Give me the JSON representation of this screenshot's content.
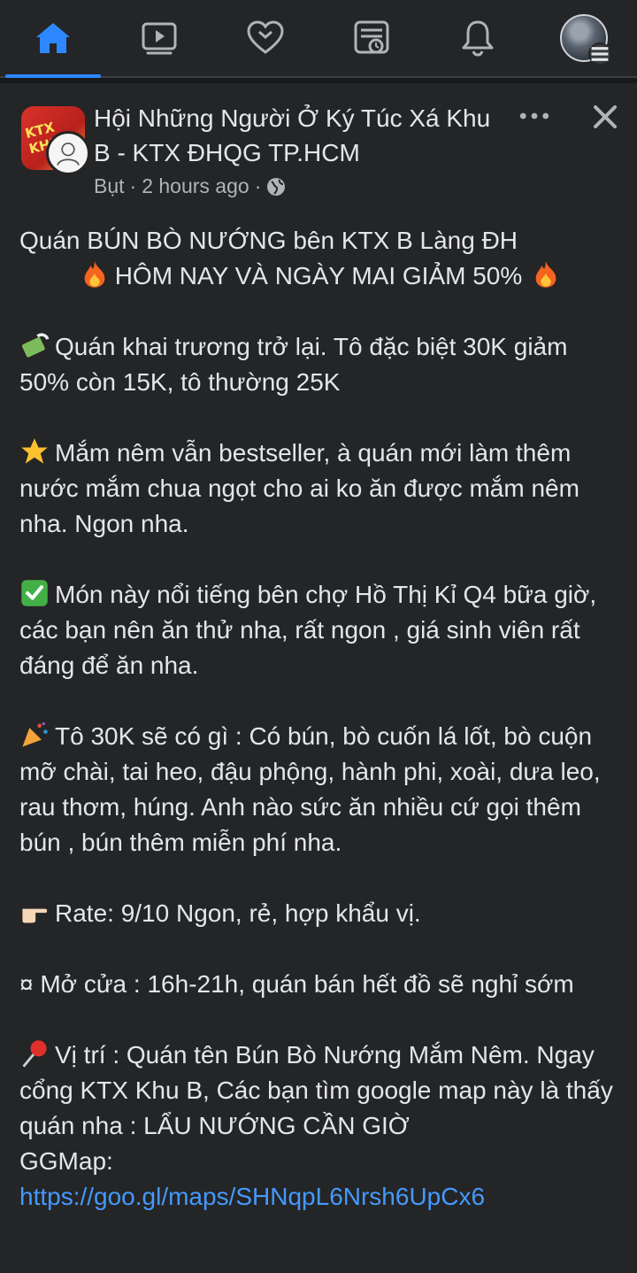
{
  "nav": {
    "items": [
      {
        "name": "home",
        "active": true
      },
      {
        "name": "watch",
        "active": false
      },
      {
        "name": "dating",
        "active": false
      },
      {
        "name": "news-feed",
        "active": false
      },
      {
        "name": "notifications",
        "active": false
      },
      {
        "name": "profile-menu",
        "active": false
      }
    ],
    "accent_color": "#2d88ff"
  },
  "post": {
    "group_name": "Hội Những Người Ở Ký Túc Xá Khu B - KTX ĐHQG TP.HCM",
    "group_avatar_text": "KTX KHU",
    "author": "Bụt",
    "separator": "·",
    "time": "2 hours ago",
    "separator2": "·",
    "audience_icon": "globe-icon",
    "body": {
      "title_line": "Quán BÚN BÒ NƯỚNG bên KTX B Làng ĐH",
      "promo_line": "HÔM NAY VÀ NGÀY MAI GIẢM 50%",
      "p1": "Quán khai trương trở lại. Tô đặc biệt 30K giảm 50% còn 15K, tô thường 25K",
      "p2": "Mắm nêm vẫn bestseller, à quán mới làm thêm nước mắm chua ngọt cho ai ko ăn được mắm nêm nha. Ngon nha.",
      "p3": "Món này nổi tiếng bên chợ Hồ Thị Kỉ Q4 bữa giờ, các bạn nên ăn thử nha, rất ngon , giá sinh viên rất đáng để ăn nha.",
      "p4": "Tô 30K sẽ có gì : Có bún, bò cuốn lá lốt, bò cuộn mỡ chài, tai heo, đậu phộng, hành phi, xoài, dưa leo, rau thơm, húng. Anh nào sức ăn nhiều cứ gọi thêm bún , bún thêm miễn phí nha.",
      "p5": "Rate: 9/10 Ngon, rẻ, hợp khẩu vị.",
      "p6": "¤ Mở cửa : 16h-21h, quán bán hết đồ sẽ nghỉ sớm",
      "p7": "Vị trí : Quán tên Bún Bò Nướng Mắm Nêm. Ngay cổng KTX Khu B, Các bạn tìm google map này là thấy quán nha : LẨU NƯỚNG CẦN GIỜ",
      "p7b": "GGMap:",
      "link": "https://goo.gl/maps/SHNqpL6Nrsh6UpCx6"
    }
  }
}
